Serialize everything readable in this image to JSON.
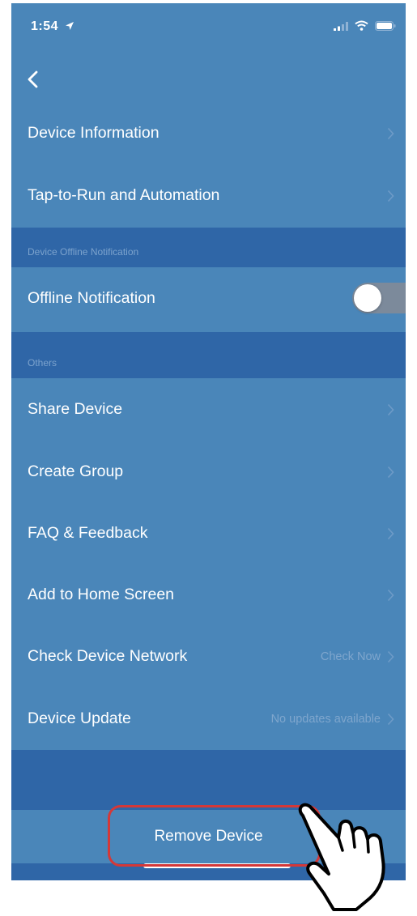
{
  "status_bar": {
    "time": "1:54"
  },
  "nav": {
    "back_icon": "chevron-left-icon"
  },
  "items_top": [
    {
      "label": "Device Information"
    },
    {
      "label": "Tap-to-Run and Automation"
    }
  ],
  "section_offline": {
    "title": "Device Offline Notification"
  },
  "offline_row": {
    "label": "Offline Notification",
    "toggle_on": false
  },
  "section_others": {
    "title": "Others"
  },
  "items_others": [
    {
      "label": "Share Device",
      "value": ""
    },
    {
      "label": "Create Group",
      "value": ""
    },
    {
      "label": "FAQ & Feedback",
      "value": ""
    },
    {
      "label": "Add to Home Screen",
      "value": ""
    },
    {
      "label": "Check Device Network",
      "value": "Check Now"
    },
    {
      "label": "Device Update",
      "value": "No updates available"
    }
  ],
  "remove_button": {
    "label": "Remove Device"
  },
  "colors": {
    "background": "#4a86b9",
    "section": "#2f66a7",
    "highlight": "#d43838"
  },
  "icons": [
    "signal-icon",
    "wifi-icon",
    "battery-icon",
    "location-arrow-icon",
    "chevron-right-icon",
    "pointing-hand-icon"
  ]
}
